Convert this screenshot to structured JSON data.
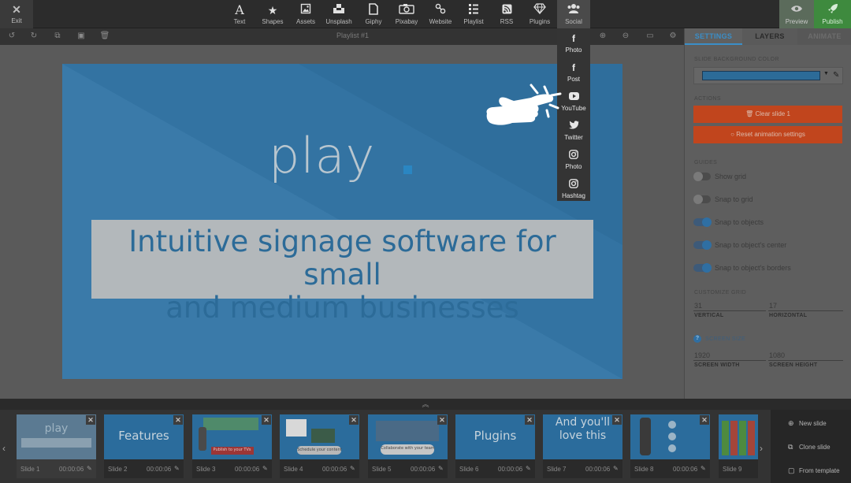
{
  "topbar": {
    "exit_label": "Exit",
    "tools": [
      {
        "label": "Text",
        "icon": "text-icon"
      },
      {
        "label": "Shapes",
        "icon": "star-icon"
      },
      {
        "label": "Assets",
        "icon": "image-icon"
      },
      {
        "label": "Unsplash",
        "icon": "unsplash-icon"
      },
      {
        "label": "Giphy",
        "icon": "giphy-icon"
      },
      {
        "label": "Pixabay",
        "icon": "camera-icon"
      },
      {
        "label": "Website",
        "icon": "link-icon"
      },
      {
        "label": "Playlist",
        "icon": "list-icon"
      },
      {
        "label": "RSS",
        "icon": "rss-icon"
      },
      {
        "label": "Plugins",
        "icon": "diamond-icon"
      },
      {
        "label": "Social",
        "icon": "users-icon"
      }
    ],
    "preview_label": "Preview",
    "publish_label": "Publish"
  },
  "subbar": {
    "title": "Playlist #1"
  },
  "social_menu": {
    "items": [
      {
        "label": "Photo",
        "icon": "facebook-icon"
      },
      {
        "label": "Post",
        "icon": "facebook-icon"
      },
      {
        "label": "YouTube",
        "icon": "youtube-icon"
      },
      {
        "label": "Twitter",
        "icon": "twitter-icon"
      },
      {
        "label": "Photo",
        "icon": "instagram-icon"
      },
      {
        "label": "Hashtag",
        "icon": "instagram-icon"
      }
    ]
  },
  "slide": {
    "logo": "play",
    "headline_line1": "Intuitive signage software for small",
    "headline_line2": "and medium businesses",
    "background_color": "#2f6e9c"
  },
  "panel": {
    "tabs": {
      "settings": "SETTINGS",
      "layers": "LAYERS",
      "animate": "ANIMATE"
    },
    "bg_color_label": "SLIDE BACKGROUND COLOR",
    "actions_label": "ACTIONS",
    "clear_slide": "Clear slide 1",
    "reset_animation": "Reset animation settings",
    "guides_label": "GUIDES",
    "guides": [
      {
        "label": "Show grid",
        "on": false
      },
      {
        "label": "Snap to grid",
        "on": false
      },
      {
        "label": "Snap to objects",
        "on": true
      },
      {
        "label": "Snap to object's center",
        "on": true
      },
      {
        "label": "Snap to object's borders",
        "on": true
      }
    ],
    "customize_grid_label": "CUSTOMIZE GRID",
    "grid_vertical_value": "31",
    "grid_horizontal_value": "17",
    "vertical_label": "VERTICAL",
    "horizontal_label": "HORIZONTAL",
    "screen_size_label": "SCREEN SIZE",
    "screen_width_value": "1920",
    "screen_height_value": "1080",
    "screen_width_label": "SCREEN WIDTH",
    "screen_height_label": "SCREEN HEIGHT"
  },
  "filmstrip": {
    "slides": [
      {
        "name": "Slide 1",
        "duration": "00:00:06",
        "text": "play"
      },
      {
        "name": "Slide 2",
        "duration": "00:00:06",
        "text": "Features"
      },
      {
        "name": "Slide 3",
        "duration": "00:00:06",
        "text": "Publish to your TVs"
      },
      {
        "name": "Slide 4",
        "duration": "00:00:06",
        "text": "Schedule your content"
      },
      {
        "name": "Slide 5",
        "duration": "00:00:06",
        "text": "Collaborate with your team"
      },
      {
        "name": "Slide 6",
        "duration": "00:00:06",
        "text": "Plugins"
      },
      {
        "name": "Slide 7",
        "duration": "00:00:06",
        "text": "And you'll love this"
      },
      {
        "name": "Slide 8",
        "duration": "00:00:06",
        "text": ""
      },
      {
        "name": "Slide 9",
        "duration": "",
        "text": ""
      }
    ],
    "new_slide": "New slide",
    "clone_slide": "Clone slide",
    "from_template": "From template"
  }
}
